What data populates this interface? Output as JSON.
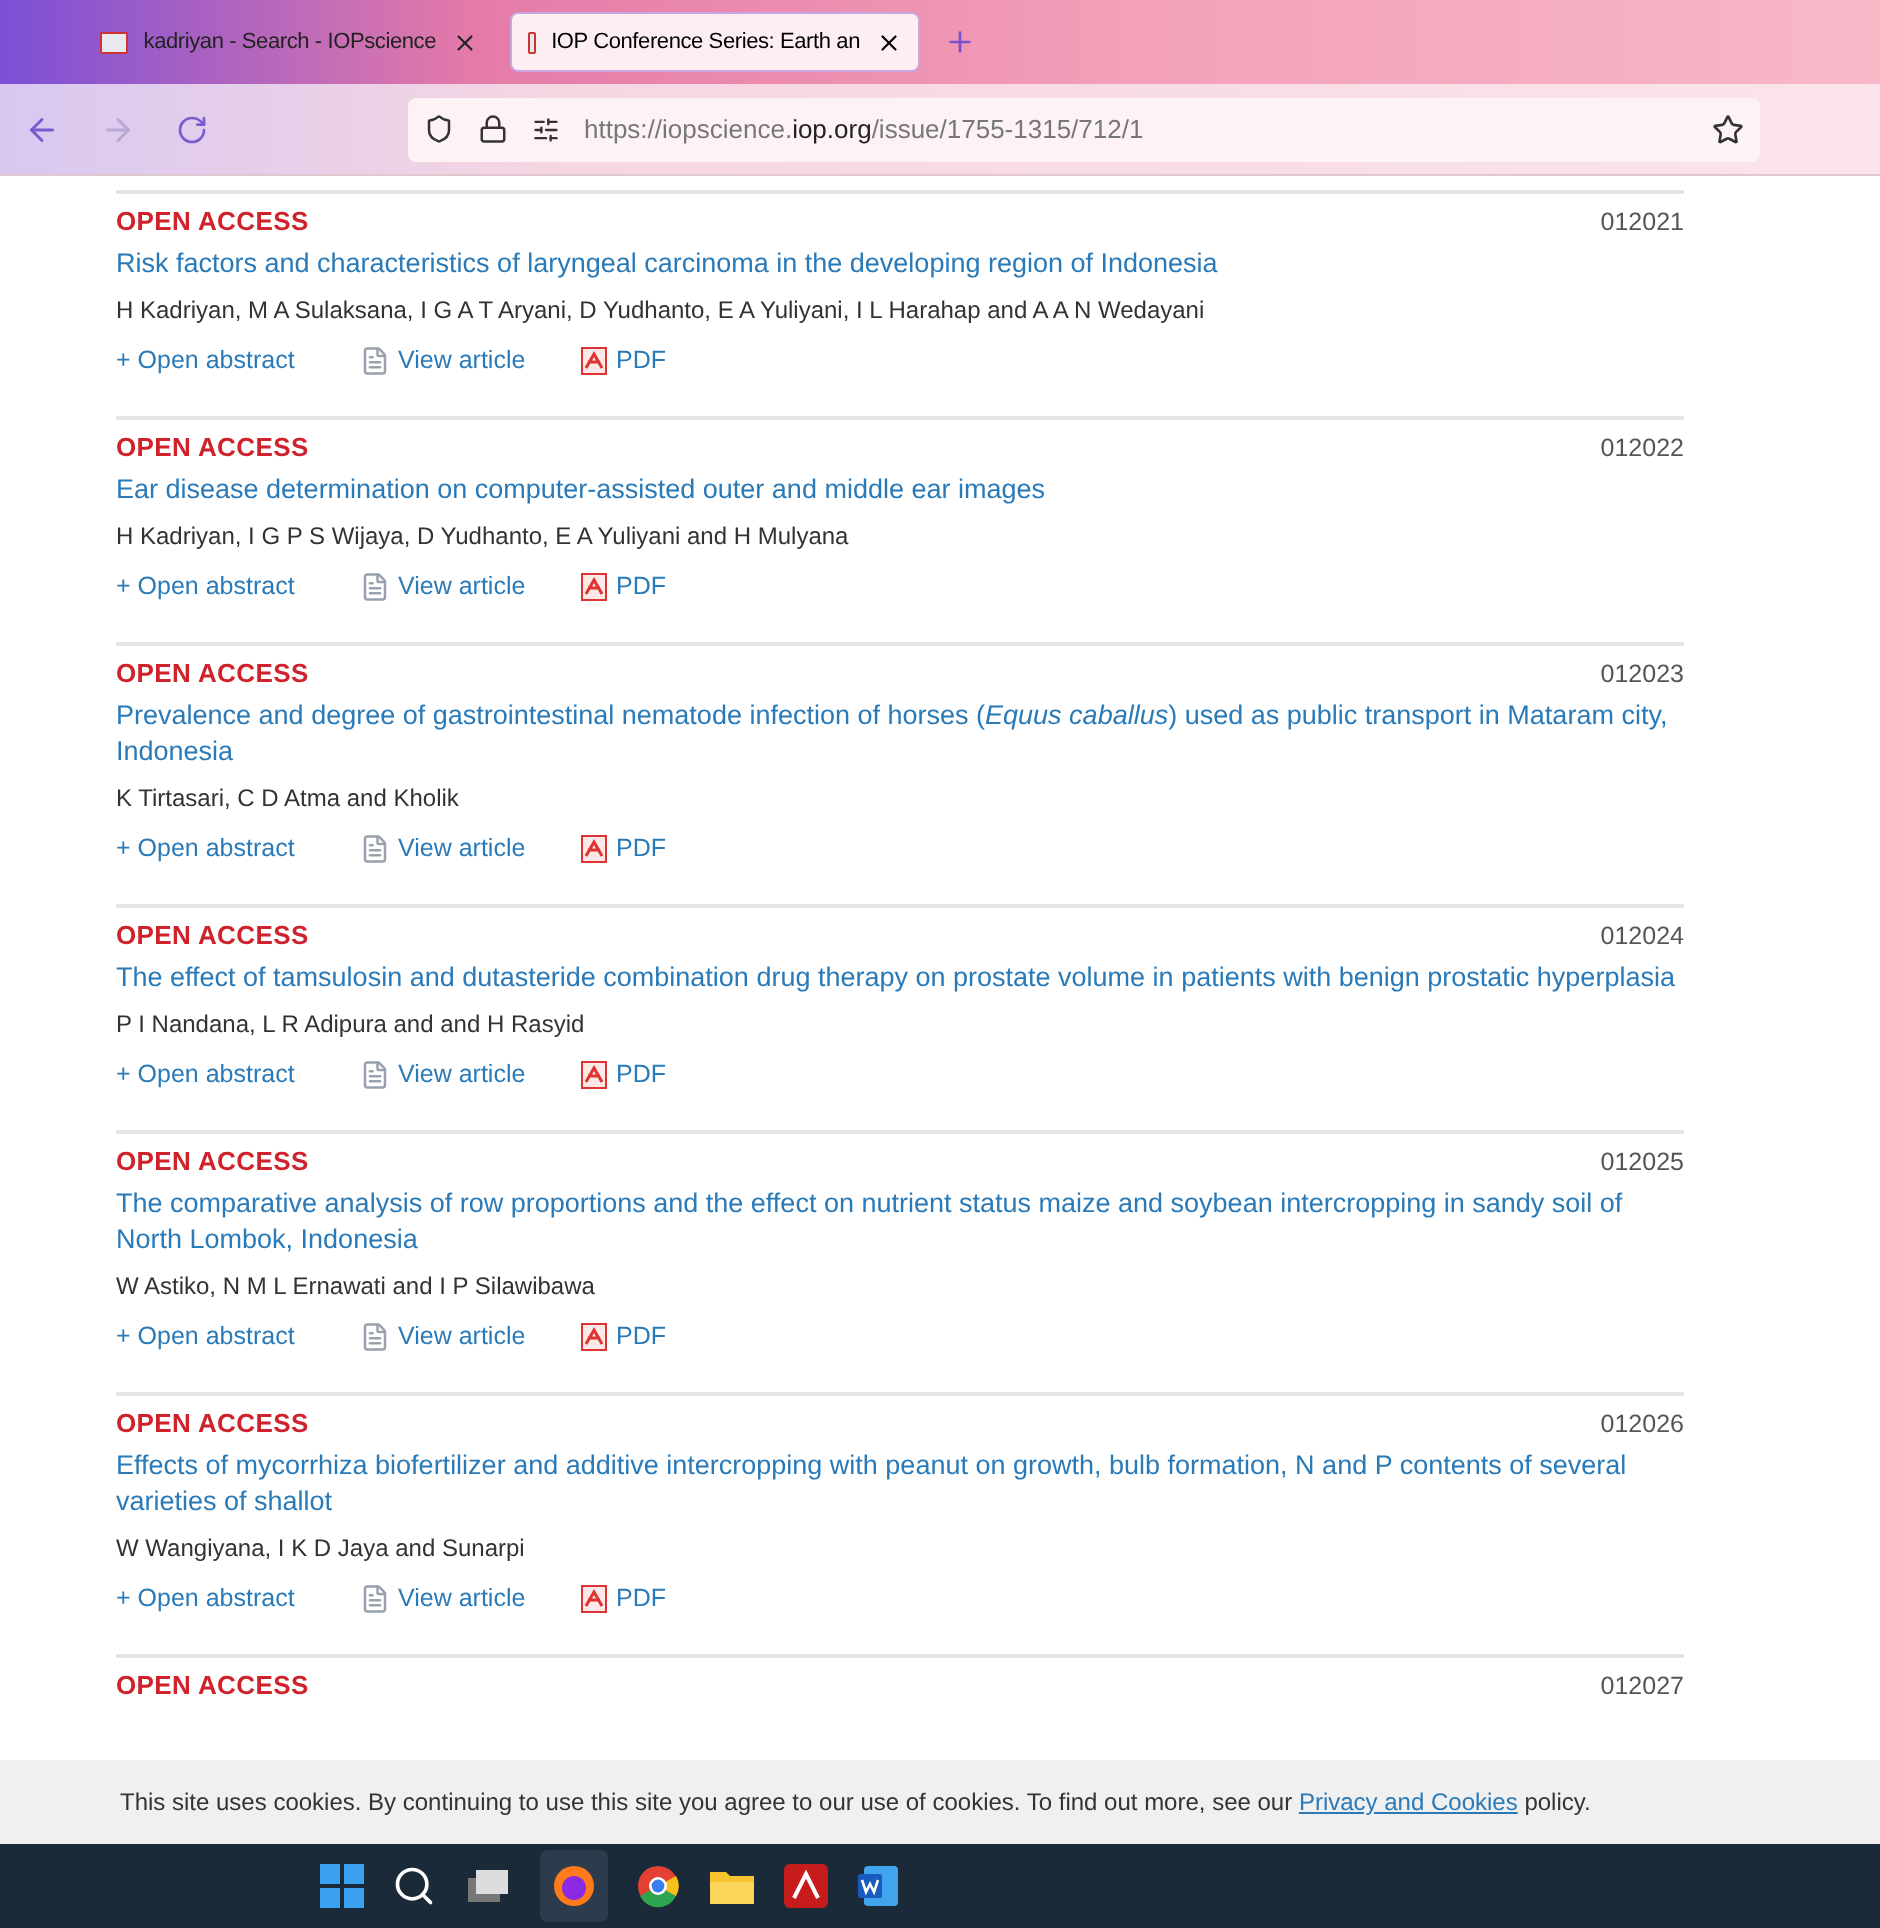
{
  "browser": {
    "tabs": [
      {
        "label": "kadriyan - Search - IOPscience",
        "selected": false
      },
      {
        "label": "IOP Conference Series: Earth an",
        "selected": true
      }
    ],
    "url_prefix": "https://iopscience.",
    "url_host": "iop.org",
    "url_path": "/issue/1755-1315/712/1"
  },
  "articles": [
    {
      "access": "OPEN ACCESS",
      "number": "012021",
      "title": "Risk factors and characteristics of laryngeal carcinoma in the developing region of Indonesia",
      "authors": "H Kadriyan, M A Sulaksana, I G A T Aryani, D Yudhanto, E A Yuliyani, I L Harahap and A A N Wedayani",
      "links": [
        "+ Open abstract",
        "View article",
        "PDF"
      ]
    },
    {
      "access": "OPEN ACCESS",
      "number": "012022",
      "title": "Ear disease determination on computer-assisted outer and middle ear images",
      "authors": "H Kadriyan, I G P S Wijaya, D Yudhanto, E A Yuliyani and H Mulyana",
      "links": [
        "+ Open abstract",
        "View article",
        "PDF"
      ]
    },
    {
      "access": "OPEN ACCESS",
      "number": "012023",
      "title": "Prevalence and degree of gastrointestinal nematode infection of horses (*Equus caballus*) used as public transport in Mataram city, Indonesia",
      "authors": "K Tirtasari, C D Atma and Kholik",
      "links": [
        "+ Open abstract",
        "View article",
        "PDF"
      ]
    },
    {
      "access": "OPEN ACCESS",
      "number": "012024",
      "title": "The effect of tamsulosin and dutasteride combination drug therapy on prostate volume in patients with benign prostatic hyperplasia",
      "authors": "P I Nandana, L R Adipura and and H Rasyid",
      "links": [
        "+ Open abstract",
        "View article",
        "PDF"
      ]
    },
    {
      "access": "OPEN ACCESS",
      "number": "012025",
      "title": "The comparative analysis of row proportions and the effect on nutrient status maize and soybean intercropping in sandy soil of North Lombok, Indonesia",
      "authors": "W Astiko, N M L Ernawati and I P Silawibawa",
      "links": [
        "+ Open abstract",
        "View article",
        "PDF"
      ]
    },
    {
      "access": "OPEN ACCESS",
      "number": "012026",
      "title": "Effects of mycorrhiza biofertilizer and additive intercropping with peanut on growth, bulb formation, N and P contents of several varieties of shallot",
      "authors": "W Wangiyana, I K D Jaya and Sunarpi",
      "links": [
        "+ Open abstract",
        "View article",
        "PDF"
      ]
    },
    {
      "access": "OPEN ACCESS",
      "number": "012027"
    }
  ],
  "cookie_notice": {
    "text": "This site uses cookies. By continuing to use this site you agree to our use of cookies. To find out more, see our",
    "link": "Privacy and Cookies",
    "suffix": "policy."
  }
}
